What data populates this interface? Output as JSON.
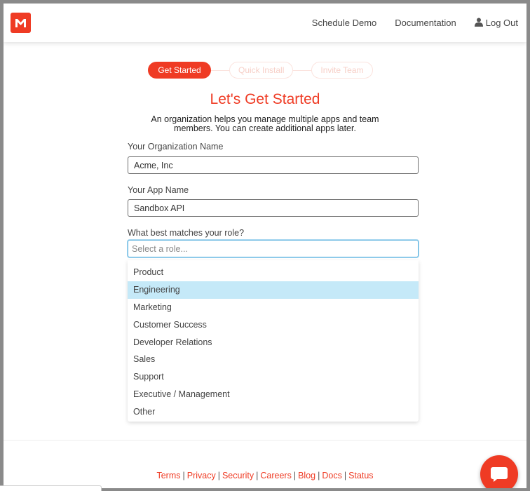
{
  "header": {
    "nav": {
      "schedule_demo": "Schedule Demo",
      "documentation": "Documentation",
      "logout": "Log Out"
    }
  },
  "stepper": {
    "steps": [
      "Get Started",
      "Quick Install",
      "Invite Team"
    ]
  },
  "form": {
    "title": "Let's Get Started",
    "subtitle": "An organization helps you manage multiple apps and team members. You can create additional apps later.",
    "org_label": "Your Organization Name",
    "org_value": "Acme, Inc",
    "app_label": "Your App Name",
    "app_value": "Sandbox API",
    "role_label": "What best matches your role?",
    "role_placeholder": "Select a role...",
    "role_options": [
      "Product",
      "Engineering",
      "Marketing",
      "Customer Success",
      "Developer Relations",
      "Sales",
      "Support",
      "Executive / Management",
      "Other"
    ]
  },
  "footer": {
    "links": [
      "Terms",
      "Privacy",
      "Security",
      "Careers",
      "Blog",
      "Docs",
      "Status"
    ]
  },
  "colors": {
    "brand": "#ef3b24",
    "highlight": "#c5e9f8",
    "focus": "#68b7e0"
  },
  "icons": {
    "logo": "moesif-logo",
    "user": "user-icon",
    "chat": "chat-icon"
  }
}
